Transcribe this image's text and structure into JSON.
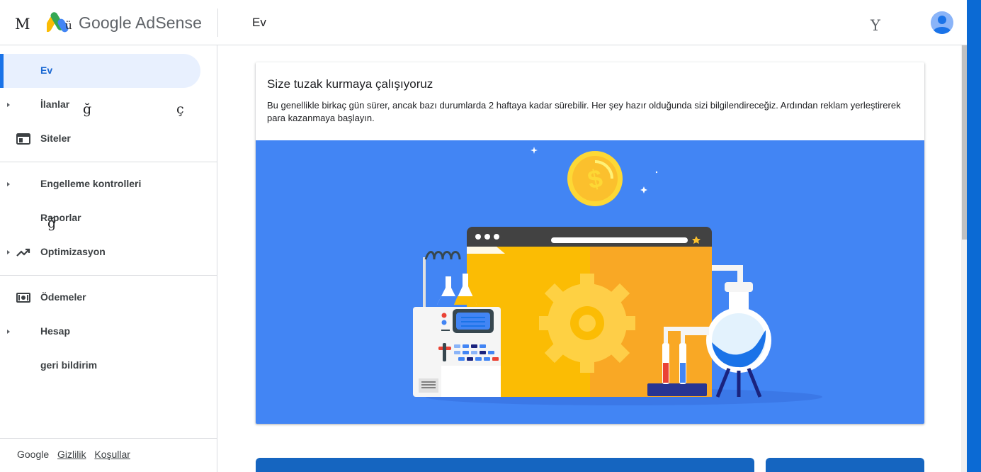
{
  "header": {
    "menu_glyph": "M",
    "logo_glyph": "ü",
    "logo_text": "Google AdSense",
    "page_title": "Ev",
    "right_glyph": "Y"
  },
  "sidebar": {
    "items": [
      {
        "label": "Ev",
        "active": true,
        "icon": "home-icon"
      },
      {
        "label": "İlanlar",
        "caret": true,
        "glyphs": [
          "ğ",
          "ç"
        ]
      },
      {
        "label": "Siteler",
        "icon": "website-icon"
      },
      {
        "label": "Engelleme kontrolleri",
        "caret": true
      },
      {
        "label": "Raporlar",
        "glyphs": [
          "ğ"
        ]
      },
      {
        "label": "Optimizasyon",
        "caret": true,
        "icon": "trending-up-icon"
      },
      {
        "label": "Ödemeler",
        "icon": "payments-icon"
      },
      {
        "label": "Hesap",
        "caret": true
      },
      {
        "label": "geri bildirim"
      }
    ],
    "footer": {
      "brand": "Google",
      "privacy": "Gizlilik",
      "terms": "Koşullar"
    }
  },
  "main": {
    "card": {
      "title": "Size tuzak kurmaya çalışıyoruz",
      "body": "Bu genellikle birkaç gün sürer, ancak bazı durumlarda 2 haftaya kadar sürebilir. Her şey hazır olduğunda sizi bilgilendireceğiz. Ardından reklam yerleştirerek para kazanmaya başlayın."
    }
  },
  "colors": {
    "accent": "#1a73e8",
    "illustration_bg": "#4285f4",
    "active_pill": "#e8f0fe",
    "coin": "#fbc02d",
    "browser_yellow": "#fbbc04",
    "browser_orange": "#f9a825"
  }
}
